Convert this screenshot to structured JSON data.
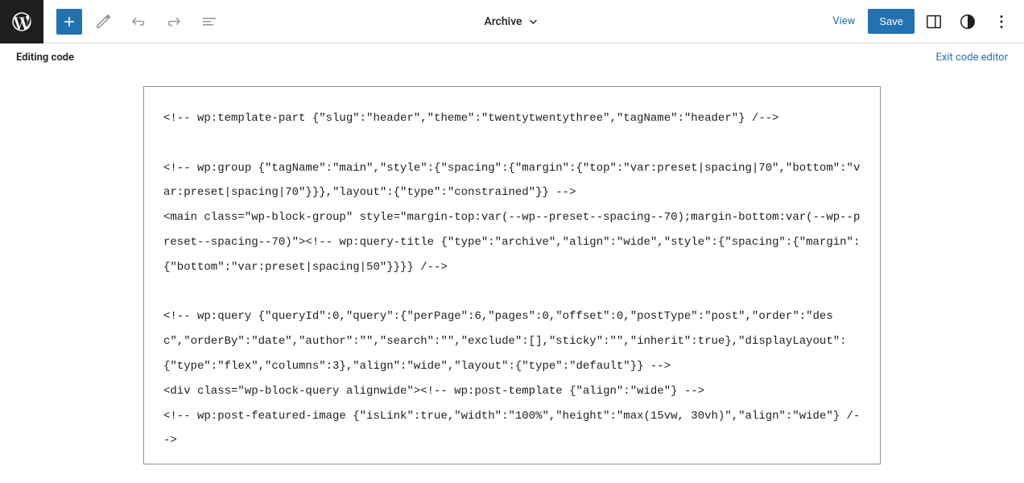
{
  "header": {
    "title": "Archive",
    "view_label": "View",
    "save_label": "Save"
  },
  "mode_bar": {
    "editing_label": "Editing code",
    "exit_label": "Exit code editor"
  },
  "code": "<!-- wp:template-part {\"slug\":\"header\",\"theme\":\"twentytwentythree\",\"tagName\":\"header\"} /-->\n\n<!-- wp:group {\"tagName\":\"main\",\"style\":{\"spacing\":{\"margin\":{\"top\":\"var:preset|spacing|70\",\"bottom\":\"var:preset|spacing|70\"}}},\"layout\":{\"type\":\"constrained\"}} -->\n<main class=\"wp-block-group\" style=\"margin-top:var(--wp--preset--spacing--70);margin-bottom:var(--wp--preset--spacing--70)\"><!-- wp:query-title {\"type\":\"archive\",\"align\":\"wide\",\"style\":{\"spacing\":{\"margin\":{\"bottom\":\"var:preset|spacing|50\"}}}} /-->\n\n<!-- wp:query {\"queryId\":0,\"query\":{\"perPage\":6,\"pages\":0,\"offset\":0,\"postType\":\"post\",\"order\":\"desc\",\"orderBy\":\"date\",\"author\":\"\",\"search\":\"\",\"exclude\":[],\"sticky\":\"\",\"inherit\":true},\"displayLayout\":{\"type\":\"flex\",\"columns\":3},\"align\":\"wide\",\"layout\":{\"type\":\"default\"}} -->\n<div class=\"wp-block-query alignwide\"><!-- wp:post-template {\"align\":\"wide\"} -->\n<!-- wp:post-featured-image {\"isLink\":true,\"width\":\"100%\",\"height\":\"max(15vw, 30vh)\",\"align\":\"wide\"} /-->"
}
